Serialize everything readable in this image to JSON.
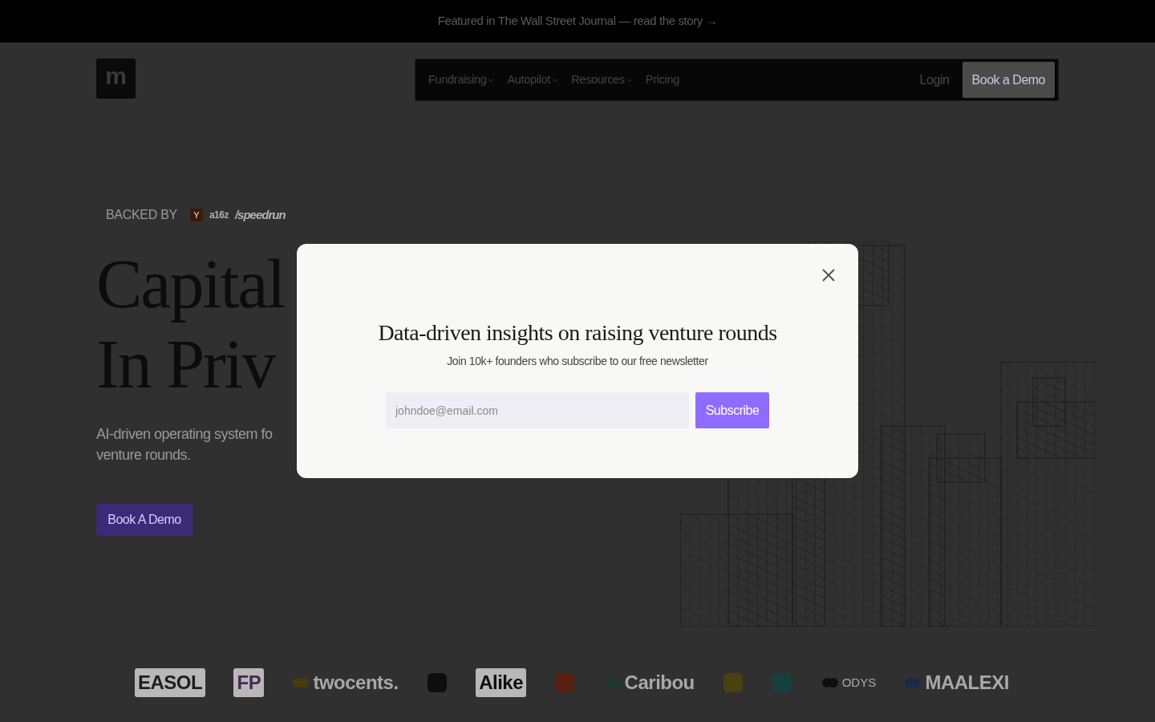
{
  "banner": {
    "text": "Featured in The Wall Street Journal — read the story →"
  },
  "header": {
    "logo": "m",
    "nav": [
      {
        "label": "Fundraising",
        "dropdown": true
      },
      {
        "label": "Autopilot",
        "dropdown": true
      },
      {
        "label": "Resources",
        "dropdown": true
      },
      {
        "label": "Pricing",
        "dropdown": false
      }
    ],
    "login": "Login",
    "cta": "Book a Demo"
  },
  "hero": {
    "backed_by": "BACKED BY",
    "backers": [
      {
        "kind": "badge",
        "text": "Y",
        "color": "#3a1a0c"
      },
      {
        "kind": "wordmark",
        "text": "a16z"
      },
      {
        "kind": "script",
        "text": "/speedrun"
      }
    ],
    "headline": [
      "Capital",
      "In Priv"
    ],
    "subtitle": [
      "AI-driven operating system fo",
      "venture rounds."
    ],
    "cta": "Book A Demo"
  },
  "logos": [
    {
      "kind": "wordmark",
      "text": "EASOL",
      "color": "#1e1e1e"
    },
    {
      "kind": "wordmark",
      "text": "FP",
      "color": "#4a2a52"
    },
    {
      "kind": "mark_wordmark",
      "text": "twocents.",
      "color": "#4a3a10"
    },
    {
      "kind": "icon",
      "color": "#0e0e0e"
    },
    {
      "kind": "wordmark",
      "text": "Alike",
      "color": "#0e0e0e"
    },
    {
      "kind": "icon",
      "color": "#5a2010"
    },
    {
      "kind": "mark_wordmark",
      "text": "Caribou",
      "color": "#1e3a30"
    },
    {
      "kind": "icon",
      "color": "#4a4010"
    },
    {
      "kind": "icon",
      "color": "#144040"
    },
    {
      "kind": "mark_wordmark",
      "text": "ODYS",
      "color": "#0e0e0e"
    },
    {
      "kind": "mark_wordmark",
      "text": "MAALEXI",
      "color": "#1a2a48"
    }
  ],
  "modal": {
    "title": "Data-driven insights on raising venture rounds",
    "subtitle": "Join 10k+ founders who subscribe to our free newsletter",
    "email_placeholder": "johndoe@email.com",
    "button": "Subscribe"
  }
}
